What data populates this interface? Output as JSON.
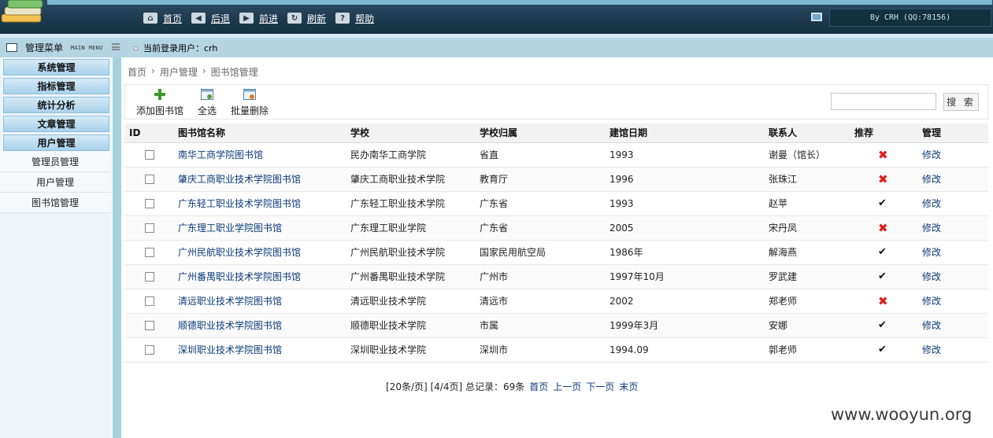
{
  "header": {
    "nav": [
      {
        "label": "首页",
        "icon": "home-icon"
      },
      {
        "label": "后退",
        "icon": "back-arrow-icon"
      },
      {
        "label": "前进",
        "icon": "forward-arrow-icon"
      },
      {
        "label": "刷新",
        "icon": "refresh-icon"
      },
      {
        "label": "帮助",
        "icon": "help-icon"
      }
    ],
    "author": "By CRH (QQ:78156)"
  },
  "menu_header": {
    "title": "管理菜单",
    "subtitle": "MAIN MENU"
  },
  "current_user": "当前登录用户：crh",
  "sidebar": {
    "categories": [
      "系统管理",
      "指标管理",
      "统计分析",
      "文章管理",
      "用户管理"
    ],
    "subitems": [
      "管理员管理",
      "用户管理",
      "图书馆管理"
    ]
  },
  "breadcrumb": [
    "首页",
    "›",
    "用户管理",
    "›",
    "图书馆管理"
  ],
  "toolbar": {
    "add": "添加图书馆",
    "select_all": "全选",
    "batch_delete": "批量删除",
    "search": "搜 索"
  },
  "table": {
    "headers": [
      "ID",
      "图书馆名称",
      "学校",
      "学校归属",
      "建馆日期",
      "联系人",
      "推荐",
      "管理"
    ],
    "rows": [
      {
        "name": "南华工商学院图书馆",
        "school": "民办南华工商学院",
        "affiliation": "省直",
        "founded": "1993",
        "contact": "谢曼（馆长）",
        "recommended": false,
        "action": "修改"
      },
      {
        "name": "肇庆工商职业技术学院图书馆",
        "school": "肇庆工商职业技术学院",
        "affiliation": "教育厅",
        "founded": "1996",
        "contact": "张珠江",
        "recommended": false,
        "action": "修改"
      },
      {
        "name": "广东轻工职业技术学院图书馆",
        "school": "广东轻工职业技术学院",
        "affiliation": "广东省",
        "founded": "1993",
        "contact": "赵苹",
        "recommended": true,
        "action": "修改"
      },
      {
        "name": "广东理工职业学院图书馆",
        "school": "广东理工职业学院",
        "affiliation": "广东省",
        "founded": "2005",
        "contact": "宋丹凤",
        "recommended": false,
        "action": "修改"
      },
      {
        "name": "广州民航职业技术学院图书馆",
        "school": "广州民航职业技术学院",
        "affiliation": "国家民用航空局",
        "founded": "1986年",
        "contact": "解海燕",
        "recommended": true,
        "action": "修改"
      },
      {
        "name": "广州番禺职业技术学院图书馆",
        "school": "广州番禺职业技术学院",
        "affiliation": "广州市",
        "founded": "1997年10月",
        "contact": "罗武建",
        "recommended": true,
        "action": "修改"
      },
      {
        "name": "清远职业技术学院图书馆",
        "school": "清远职业技术学院",
        "affiliation": "清远市",
        "founded": "2002",
        "contact": "郑老师",
        "recommended": false,
        "action": "修改"
      },
      {
        "name": "顺德职业技术学院图书馆",
        "school": "顺德职业技术学院",
        "affiliation": "市属",
        "founded": "1999年3月",
        "contact": "安娜",
        "recommended": true,
        "action": "修改"
      },
      {
        "name": "深圳职业技术学院图书馆",
        "school": "深圳职业技术学院",
        "affiliation": "深圳市",
        "founded": "1994.09",
        "contact": "郭老师",
        "recommended": true,
        "action": "修改"
      }
    ]
  },
  "pager": {
    "info": "[20条/页] [4/4页] 总记录：69条",
    "first": "首页",
    "prev": "上一页",
    "next": "下一页",
    "last": "末页"
  },
  "watermark": "www.wooyun.org",
  "colors": {
    "header_bg": "#1e3a4f",
    "sidebar_cat": "#a9d2ec",
    "link": "#0b3a7a",
    "no_flag": "#e01a1a"
  }
}
